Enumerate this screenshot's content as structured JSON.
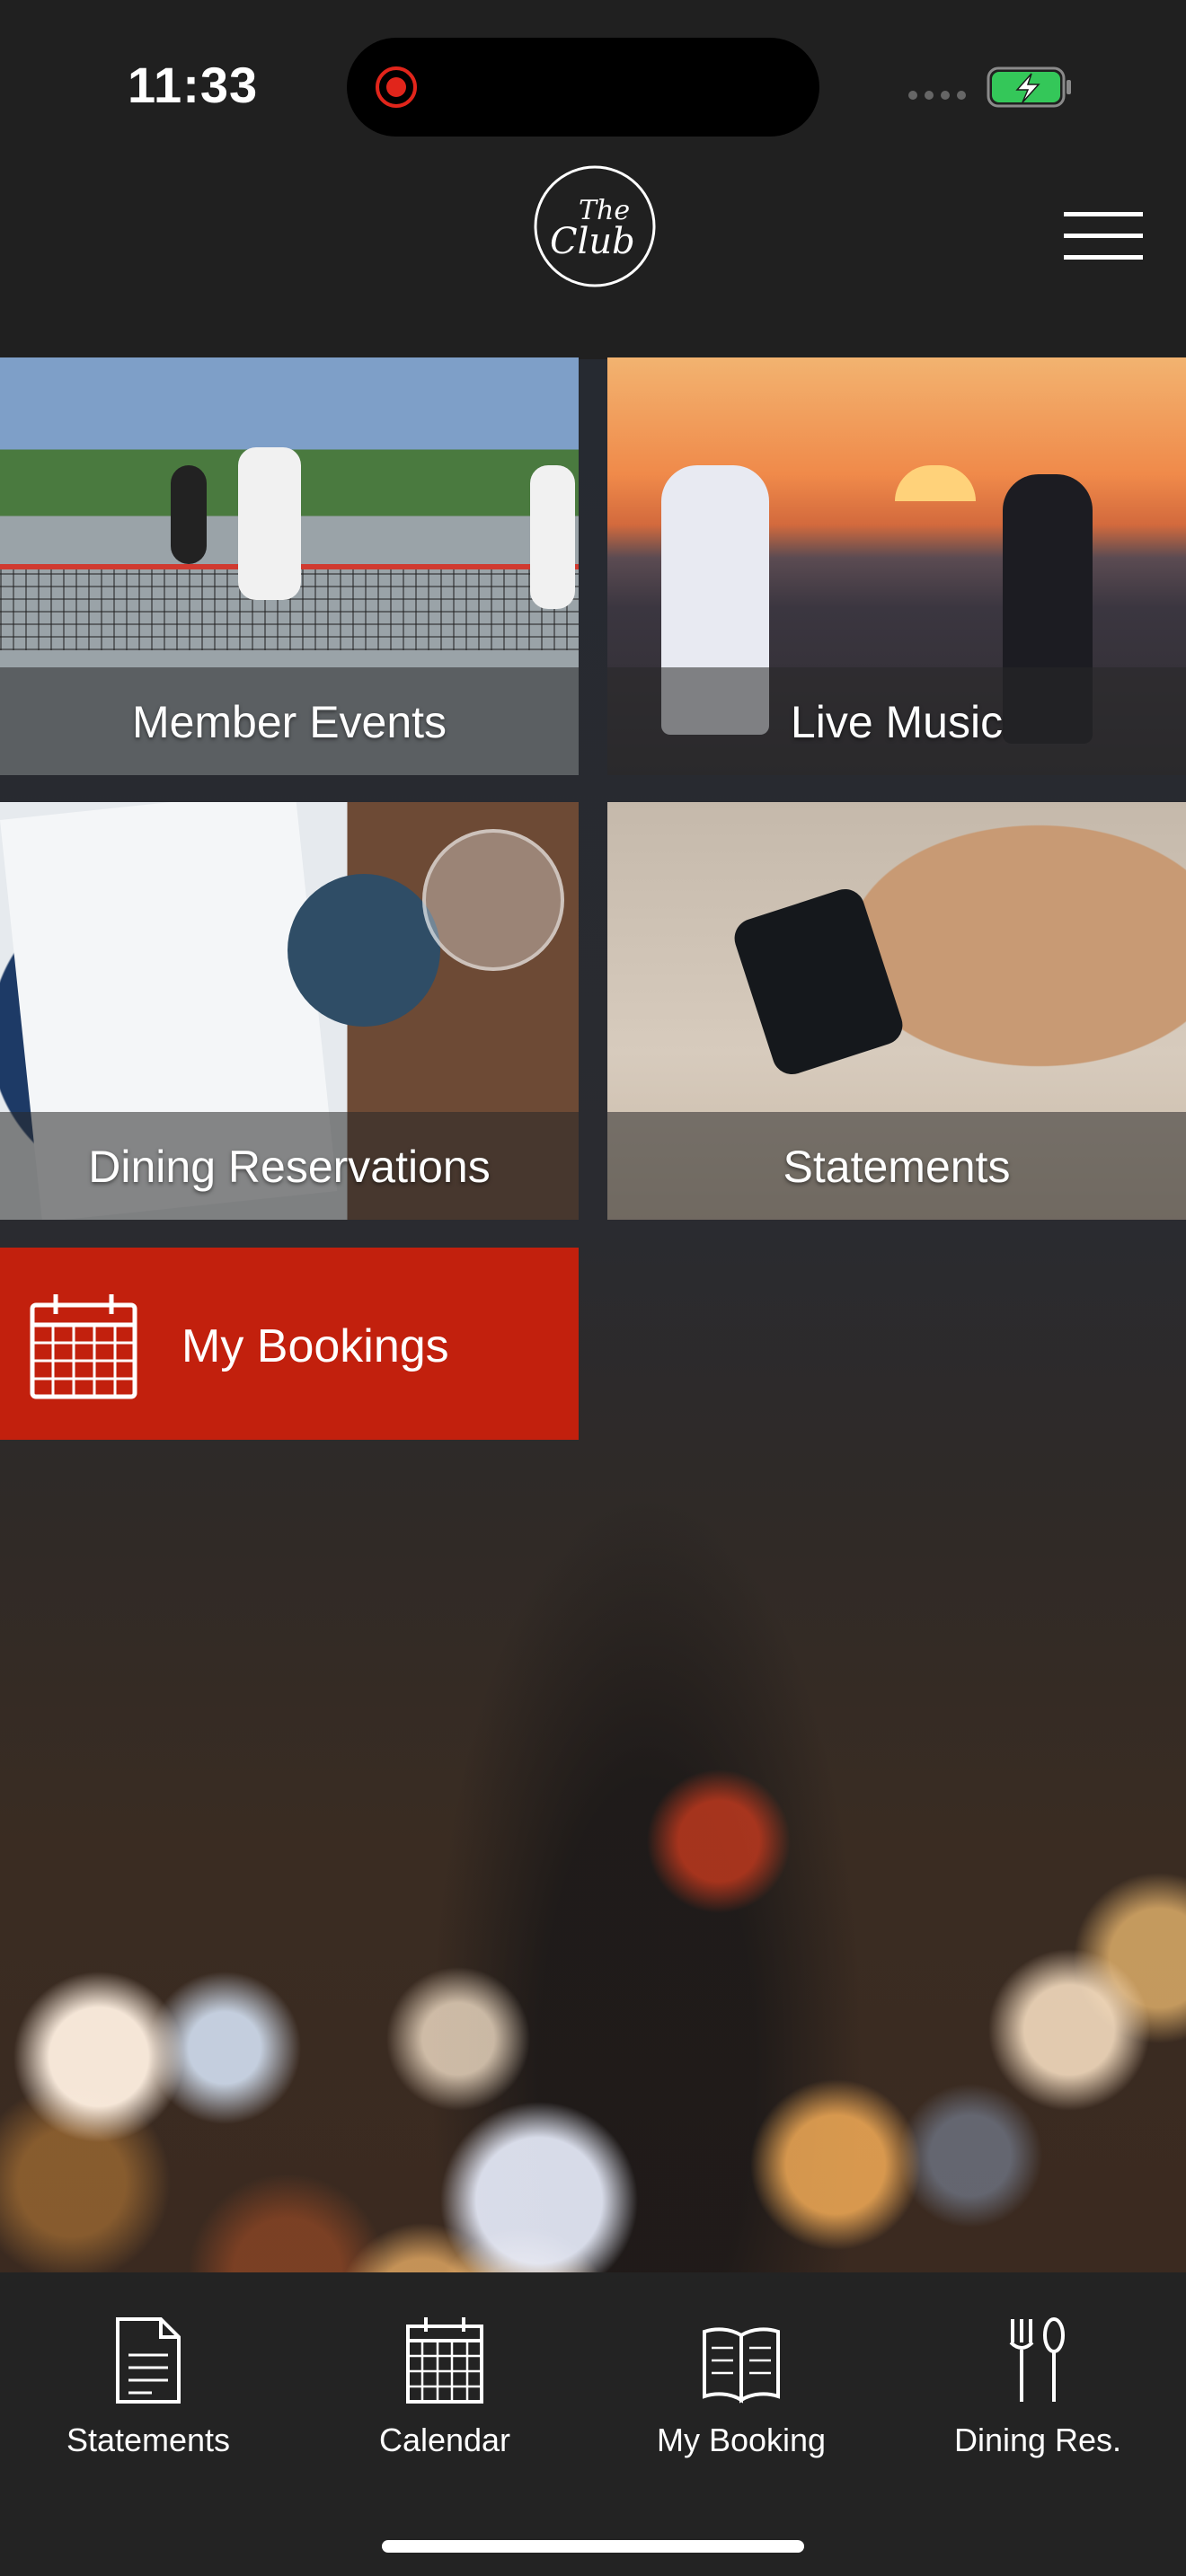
{
  "status_bar": {
    "time": "11:33",
    "recording_color": "#e1251b",
    "battery_color": "#34c759"
  },
  "header": {
    "logo_text_line1": "The",
    "logo_text_line2": "Club",
    "menu_icon": "hamburger-menu-icon"
  },
  "tiles": [
    {
      "label": "Member Events"
    },
    {
      "label": "Live Music"
    },
    {
      "label": "Dining Reservations"
    },
    {
      "label": "Statements"
    }
  ],
  "bookings": {
    "label": "My Bookings",
    "icon": "calendar-icon",
    "color": "#c2200d"
  },
  "tabbar": {
    "items": [
      {
        "label": "Statements",
        "icon": "document-icon"
      },
      {
        "label": "Calendar",
        "icon": "calendar-icon"
      },
      {
        "label": "My Booking",
        "icon": "open-book-icon"
      },
      {
        "label": "Dining Res.",
        "icon": "fork-knife-icon"
      }
    ]
  }
}
